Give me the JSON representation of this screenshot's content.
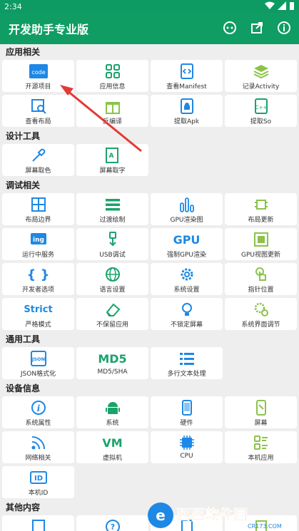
{
  "status": {
    "time": "2:34"
  },
  "appbar": {
    "title": "开发助手专业版"
  },
  "sections": {
    "app": {
      "title": "应用相关",
      "items": [
        "开源项目",
        "应用信息",
        "查看Manifest",
        "记录Activity",
        "查看布局",
        "反编译",
        "提取Apk",
        "提取So"
      ]
    },
    "design": {
      "title": "设计工具",
      "items": [
        "屏幕取色",
        "屏幕取字"
      ]
    },
    "debug": {
      "title": "调试相关",
      "items": [
        "布局边界",
        "过渡绘制",
        "GPU渲染图",
        "布局更新",
        "运行中服务",
        "USB调试",
        "强制GPU渲染",
        "GPU视图更新",
        "开发者选项",
        "语言设置",
        "系统设置",
        "指针位置",
        "严格模式",
        "不保留应用",
        "不锁定屏幕",
        "系统界面调节"
      ]
    },
    "common": {
      "title": "通用工具",
      "items": [
        "JSON格式化",
        "MD5/SHA",
        "多行文本处理"
      ]
    },
    "device": {
      "title": "设备信息",
      "items": [
        "系统属性",
        "系统",
        "硬件",
        "屏幕",
        "网络相关",
        "虚拟机",
        "CPU",
        "本机应用",
        "本机ID"
      ]
    },
    "other": {
      "title": "其他内容"
    }
  },
  "icon_text": {
    "code": "code",
    "ing": "ing",
    "gpu": "GPU",
    "strict": "Strict",
    "json": "JSON",
    "md5": "MD5",
    "vm": "VM",
    "id": "ID"
  },
  "watermark": {
    "brand": "西西软件园",
    "url": "CR173.COM"
  },
  "colors": {
    "primary": "#0f9d63",
    "icon_green": "#1aa36b",
    "icon_blue": "#1e88e5"
  }
}
